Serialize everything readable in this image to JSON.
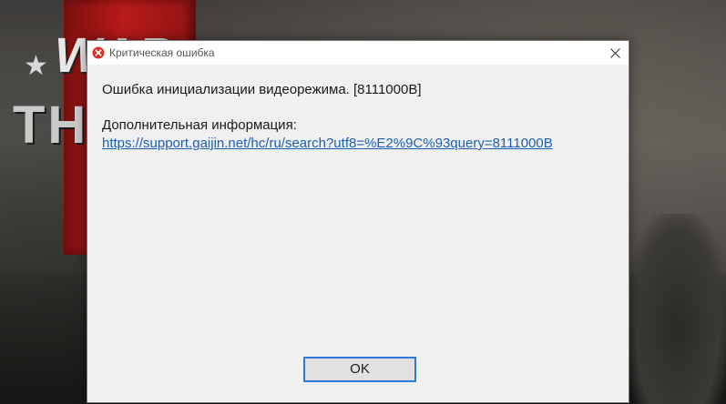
{
  "background": {
    "logo_top": "WAR",
    "logo_bottom": "THU"
  },
  "dialog": {
    "title": "Критическая ошибка",
    "title_icon": "error-icon",
    "close_icon": "close-icon",
    "message": "Ошибка инициализации видеорежима. [8111000B]",
    "info_label": "Дополнительная информация:",
    "info_link": "https://support.gaijin.net/hc/ru/search?utf8=%E2%9C%93query=8111000B",
    "ok_label": "OK"
  },
  "colors": {
    "error_red": "#d9322b",
    "link_blue": "#1a5fb4",
    "focus_blue": "#2f7ad6"
  }
}
